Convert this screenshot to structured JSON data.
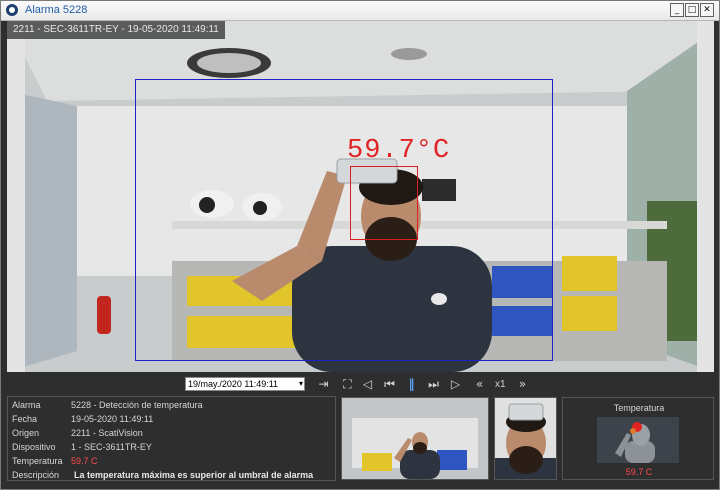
{
  "window": {
    "title": "Alarma 5228",
    "buttons": {
      "minimize": "_",
      "maximize": "□",
      "close": "✕"
    }
  },
  "video": {
    "camera_info": "2211 - SEC-3611TR-EY - 19-05-2020 11:49:11",
    "temperature_overlay": "59.7°C"
  },
  "controls": {
    "date_value": "19/may./2020  11:49:11",
    "speed_label": "x1",
    "icons": [
      "export-icon",
      "fullscreen-icon",
      "prev-icon",
      "step-back-icon",
      "pause-icon",
      "step-forward-icon",
      "play-icon",
      "rewind-icon",
      "fast-forward-icon"
    ]
  },
  "details": {
    "rows": [
      {
        "label": "Alarma",
        "value": "5228 - Detección de temperatura"
      },
      {
        "label": "Fecha",
        "value": "19-05-2020 11:49:11"
      },
      {
        "label": "Origen",
        "value": "2211 - ScatiVision"
      },
      {
        "label": "Dispositivo",
        "value": "1 - SEC-3611TR-EY"
      },
      {
        "label": "Temperatura",
        "value": "59.7 C"
      },
      {
        "label": "Descripción",
        "value": "La temperatura máxima es superior al umbral de alarma"
      }
    ]
  },
  "temperature_panel": {
    "title": "Temperatura",
    "value": "59.7 C"
  },
  "colors": {
    "alarm_red": "#e02323",
    "detect_box_blue": "#2020c8",
    "accent_blue": "#5ba1f0"
  }
}
